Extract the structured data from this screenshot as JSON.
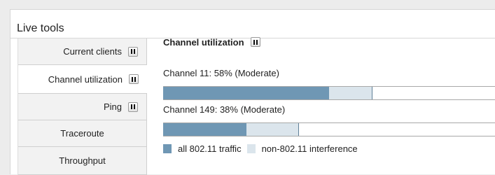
{
  "panel": {
    "title": "Live tools"
  },
  "sidebar": {
    "items": [
      {
        "label": "Current clients",
        "has_pause": true
      },
      {
        "label": "Channel utilization",
        "has_pause": true,
        "active": true
      },
      {
        "label": "Ping",
        "has_pause": true
      },
      {
        "label": "Traceroute",
        "has_pause": false
      },
      {
        "label": "Throughput",
        "has_pause": false
      }
    ]
  },
  "main": {
    "title": "Channel utilization",
    "channels": [
      {
        "label": "Channel 11: 58% (Moderate)",
        "all_80211_percent": 50,
        "non_80211_percent": 13
      },
      {
        "label": "Channel 149: 38% (Moderate)",
        "all_80211_percent": 25,
        "non_80211_percent": 16
      }
    ]
  },
  "legend": {
    "all_label": "all 802.11 traffic",
    "non_label": "non-802.11 interference"
  },
  "colors": {
    "all_80211": "#6f97b4",
    "non_80211": "#dbe5ec"
  },
  "icons": {
    "pause": "pause-icon"
  }
}
